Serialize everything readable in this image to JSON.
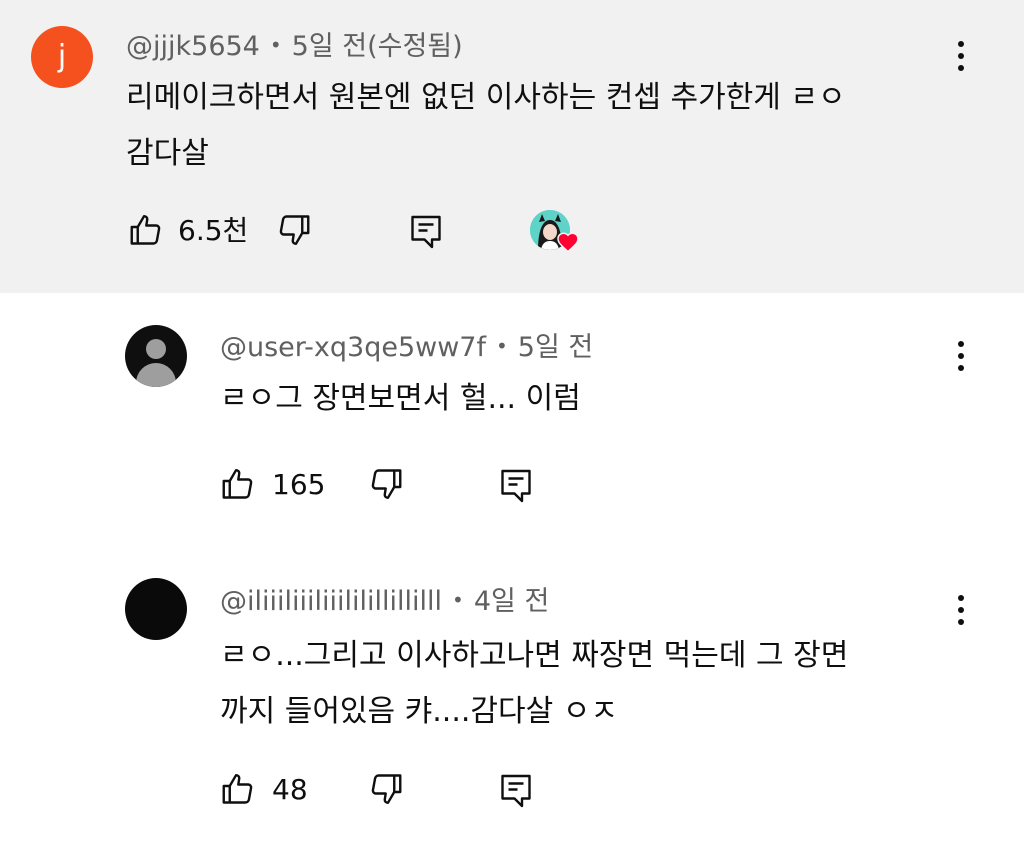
{
  "comments": [
    {
      "avatar_letter": "j",
      "avatar_color": "#f4511e",
      "handle": "@jjjk5654",
      "time": "5일 전(수정됨)",
      "text_lines": [
        "리메이크하면서 원본엔 없던 이사하는 컨셉 추가한게 ㄹㅇ",
        "감다살"
      ],
      "likes": "6.5천",
      "creator_heart": true
    },
    {
      "handle": "@user-xq3qe5ww7f",
      "time": "5일 전",
      "text_lines": [
        "ㄹㅇ그 장면보면서 헐... 이럼"
      ],
      "likes": "165"
    },
    {
      "handle": "@iliiiliiiliiililillillilll",
      "time": "4일 전",
      "text_lines": [
        "ㄹㅇ...그리고 이사하고나면 짜장면 먹는데 그 장면",
        "까지 들어있음 캬....감다살 ㅇㅈ"
      ],
      "likes": "48"
    }
  ],
  "icons": {
    "like": "thumbs-up-icon",
    "dislike": "thumbs-down-icon",
    "reply": "reply-icon",
    "more": "more-vert-icon",
    "heart": "creator-heart-icon"
  },
  "colors": {
    "highlight_bg": "#f1f1f1",
    "meta_text": "#606060",
    "heart": "#ff0033"
  }
}
